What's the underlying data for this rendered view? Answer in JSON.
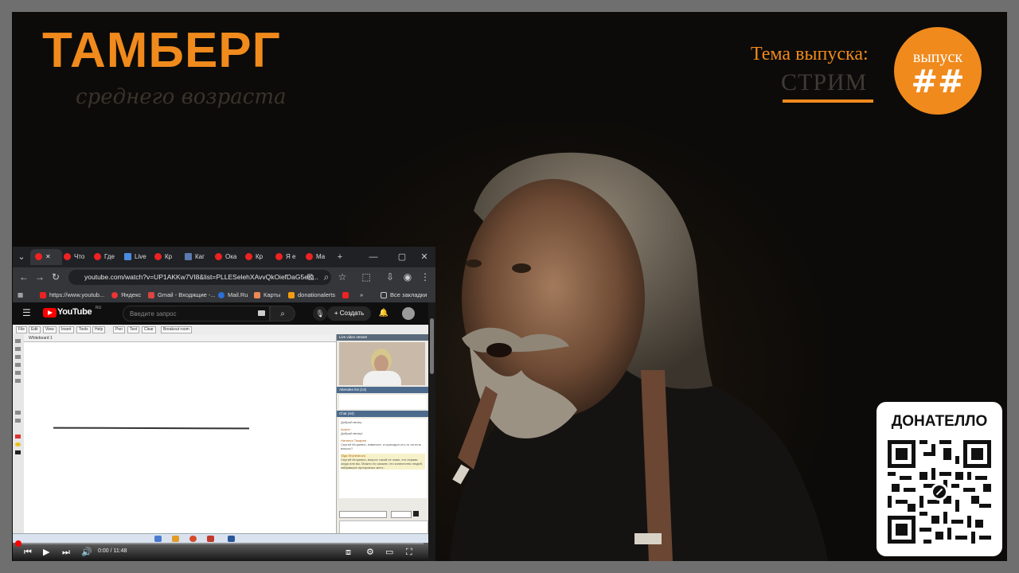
{
  "overlay": {
    "brand_title": "ТАМБЕРГ",
    "brand_subtitle": "среднего возраста",
    "topic_label": "Тема выпуска:",
    "topic_value": "СТРИМ",
    "badge_line1": "выпуск",
    "badge_line2": "##",
    "donate_title": "ДОНАТЕЛЛО",
    "accent_color": "#f08a1c"
  },
  "browser": {
    "tabs": [
      {
        "label": "",
        "icon": "youtube-icon"
      },
      {
        "label": "Что",
        "icon": "youtube-icon"
      },
      {
        "label": "Где",
        "icon": "youtube-icon"
      },
      {
        "label": "Live",
        "icon": "bookmark-icon"
      },
      {
        "label": "Кр",
        "icon": "youtube-icon"
      },
      {
        "label": "Каг",
        "icon": "page-icon"
      },
      {
        "label": "Ока",
        "icon": "youtube-icon"
      },
      {
        "label": "Кр",
        "icon": "youtube-icon"
      },
      {
        "label": "Я е",
        "icon": "youtube-icon"
      },
      {
        "label": "Ма",
        "icon": "youtube-icon"
      }
    ],
    "url": "youtube.com/watch?v=UP1AKKw7VI8&list=PLLESelehXAvvQkOiefDaG5eK...",
    "bookmarks": [
      {
        "label": "https://www.youtub..."
      },
      {
        "label": "Яндекс"
      },
      {
        "label": "Gmail - Входящие -..."
      },
      {
        "label": "Mail.Ru"
      },
      {
        "label": "Карты"
      },
      {
        "label": "donationalerts"
      }
    ],
    "all_bookmarks": "Все закладки"
  },
  "youtube": {
    "logo_text": "YouTube",
    "logo_sup": "RU",
    "search_placeholder": "Введите запрос",
    "create_label": "Создать",
    "time": "0:00 / 11:48",
    "progress": 0.0
  },
  "embedded": {
    "tools": [
      "File",
      "Edit",
      "View",
      "Insert",
      "Tools",
      "Help",
      "Pen",
      "Text",
      "Clear",
      "Breakout room"
    ],
    "whiteboard_tab": "Whiteboard 1",
    "cam_title": "Live video stream",
    "participants_title": "Attendee list (13)",
    "chat_title": "Chat (44)",
    "chat": [
      {
        "name": "",
        "text": "Добрый вечер"
      },
      {
        "name": "Andrei",
        "text": "Добрый вечер!"
      },
      {
        "name": "Наталья Тазарев",
        "text": "Сергей Игоревич, извините, а приходил кто-то ли есть вопрос?"
      },
      {
        "name": "Olga Shchedrova",
        "text": "Сергей Игоревич, вопрос такой не знаю, это первая когда или вы. Можно ли сказать что количество людей, набравших пропускных мест..."
      }
    ]
  }
}
